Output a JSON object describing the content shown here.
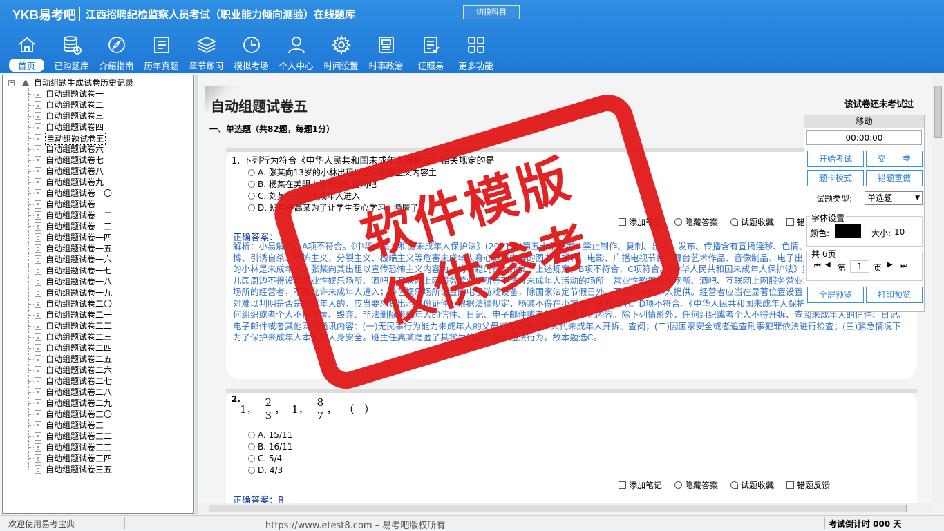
{
  "header": {
    "logo": "YKB易考吧",
    "app_title": "江西招聘纪检监察人员考试（职业能力倾向测验）在线题库",
    "switch_button": "切换科目",
    "toolbar": [
      {
        "label": "首页",
        "icon": "home-icon"
      },
      {
        "label": "已购题库",
        "icon": "database-icon"
      },
      {
        "label": "介绍指南",
        "icon": "compass-icon"
      },
      {
        "label": "历年真题",
        "icon": "document-list-icon"
      },
      {
        "label": "章节练习",
        "icon": "layers-icon"
      },
      {
        "label": "模拟考场",
        "icon": "clock-icon"
      },
      {
        "label": "个人中心",
        "icon": "user-icon"
      },
      {
        "label": "时间设置",
        "icon": "gear-icon"
      },
      {
        "label": "时事政治",
        "icon": "newspaper-icon"
      },
      {
        "label": "证照易",
        "icon": "checklist-icon"
      },
      {
        "label": "更多功能",
        "icon": "grid-icon"
      }
    ]
  },
  "tree": {
    "root": "自动组题生成试卷历史记录",
    "selected_index": 4,
    "items": [
      "自动组题试卷一",
      "自动组题试卷二",
      "自动组题试卷三",
      "自动组题试卷四",
      "自动组题试卷五",
      "自动组题试卷六",
      "自动组题试卷七",
      "自动组题试卷八",
      "自动组题试卷九",
      "自动组题试卷一〇",
      "自动组题试卷一一",
      "自动组题试卷一二",
      "自动组题试卷一三",
      "自动组题试卷一四",
      "自动组题试卷一五",
      "自动组题试卷一六",
      "自动组题试卷一七",
      "自动组题试卷一八",
      "自动组题试卷一九",
      "自动组题试卷二〇",
      "自动组题试卷二一",
      "自动组题试卷二二",
      "自动组题试卷二三",
      "自动组题试卷二四",
      "自动组题试卷二五",
      "自动组题试卷二六",
      "自动组题试卷二七",
      "自动组题试卷二八",
      "自动组题试卷二九",
      "自动组题试卷三〇",
      "自动组题试卷三一",
      "自动组题试卷三二",
      "自动组题试卷三三",
      "自动组题试卷三四",
      "自动组题试卷三五"
    ]
  },
  "paper": {
    "title": "自动组题试卷五",
    "status": "该试卷还未考试过",
    "section": "一、单选题（共82题，每题1分）"
  },
  "q1": {
    "text": "1. 下列行为符合《中华人民共和国未成年人保护法》相关规定的是",
    "options": [
      "A. 张某向13岁的小林出租以宣传恐怖主义内容主",
      "B. 杨某在美明小学周边设置网吧",
      "C. 刘某不允许未成年人进入",
      "D. 班主任高某为了让学生专心学习，隐匿了"
    ],
    "answer_label": "正确答案：",
    "explanation": "解析：小易解析，A项不符合。《中华人民共和国未成年人保护法》(2021年)第五十条规定，禁止制作、复制、出版、发布、传播含有宣扬淫秽、色情、暴力、邪教、迷信、赌博、引诱自杀、恐怖主义、分裂主义、极端主义等危害未成年人身心健康内容的图书、报刊、电影、广播电视节目、舞台艺术作品、音像制品、电子出版物和网络信息等。13岁的小林是未成年人，张某向其出租以宣传恐怖主义内容为主的书籍的行为违反了上述规定。B项不符合，C项符合。《中华人民共和国未成年人保护法》第五十八条规定，学校、幼儿园周边不得设置营业性娱乐场所、酒吧、互联网上网服务营业场所等不适宜未成年人活动的场所。营业性歌舞娱乐场所、酒吧、互联网上网服务营业场所等不适宜未成年人活动场所的经营者，不得允许未成年人进入；游艺娱乐场所设置的电子游戏设备，除国家法定节假日外，不得向未成年人提供。经营者应当在显著位置设置未成年人禁入、限入标志；对难以判明是否是未成年人的，应当要求其出示身份证件。根据法律规定，杨某不得在小学周边设置网吧。D项不符合。《中华人民共和国未成年人保护法》第六十三条规定，任何组织或者个人不得隐匿、毁弃、非法删除未成年人的信件、日记、电子邮件或者其他网络通讯内容。除下列情形外，任何组织或者个人不得开拆、查阅未成年人的信件、日记、电子邮件或者其他网络通讯内容：(一)无民事行为能力未成年人的父母或者其他监护人代未成年人开拆、查阅；(二)因国家安全或者追查刑事犯罪依法进行检查；(三)紧急情况下为了保护未成年人本人的人身安全。班主任高某隐匿了其学生的信件属于违法行为。故本题选C。"
  },
  "q2": {
    "number": "2.",
    "seq": [
      "1",
      "2/3",
      "1",
      "8/7",
      "（　）"
    ],
    "frac1": {
      "num": "2",
      "den": "3"
    },
    "frac2": {
      "num": "8",
      "den": "7"
    },
    "t1": "1，",
    "t2": "，",
    "t3": "1，",
    "t4": "，",
    "t5": "（　）",
    "options": [
      "A. 15/11",
      "B. 16/11",
      "C. 5/4",
      "D. 4/3"
    ],
    "answer_label": "正确答案：",
    "answer": "B"
  },
  "actions": {
    "note": "添加笔记",
    "hide": "隐藏答案",
    "fav": "试题收藏",
    "report": "错题反馈"
  },
  "panel": {
    "move": "移动",
    "timer": "00:00:00",
    "start": "开始考试",
    "submit": "交　　卷",
    "card_mode": "题卡模式",
    "redo": "错题重做",
    "type_label": "试题类型:",
    "type_value": "单选题",
    "font_title": "字体设置",
    "color_label": "颜色:",
    "size_label": "大小:",
    "size_value": "10",
    "color_value": "#000000",
    "pages_title": "共 6页",
    "page_prefix": "第",
    "page_value": "1",
    "page_suffix": "页",
    "fullscreen": "全屏预览",
    "print": "打印预览"
  },
  "stamp": {
    "line1": "软件模版",
    "line2": "仅供参考"
  },
  "status": {
    "welcome": "欢迎使用易考宝典",
    "url": "https://www.etest8.com – 易考吧版权所有",
    "countdown": "考试倒计时 000 天"
  }
}
